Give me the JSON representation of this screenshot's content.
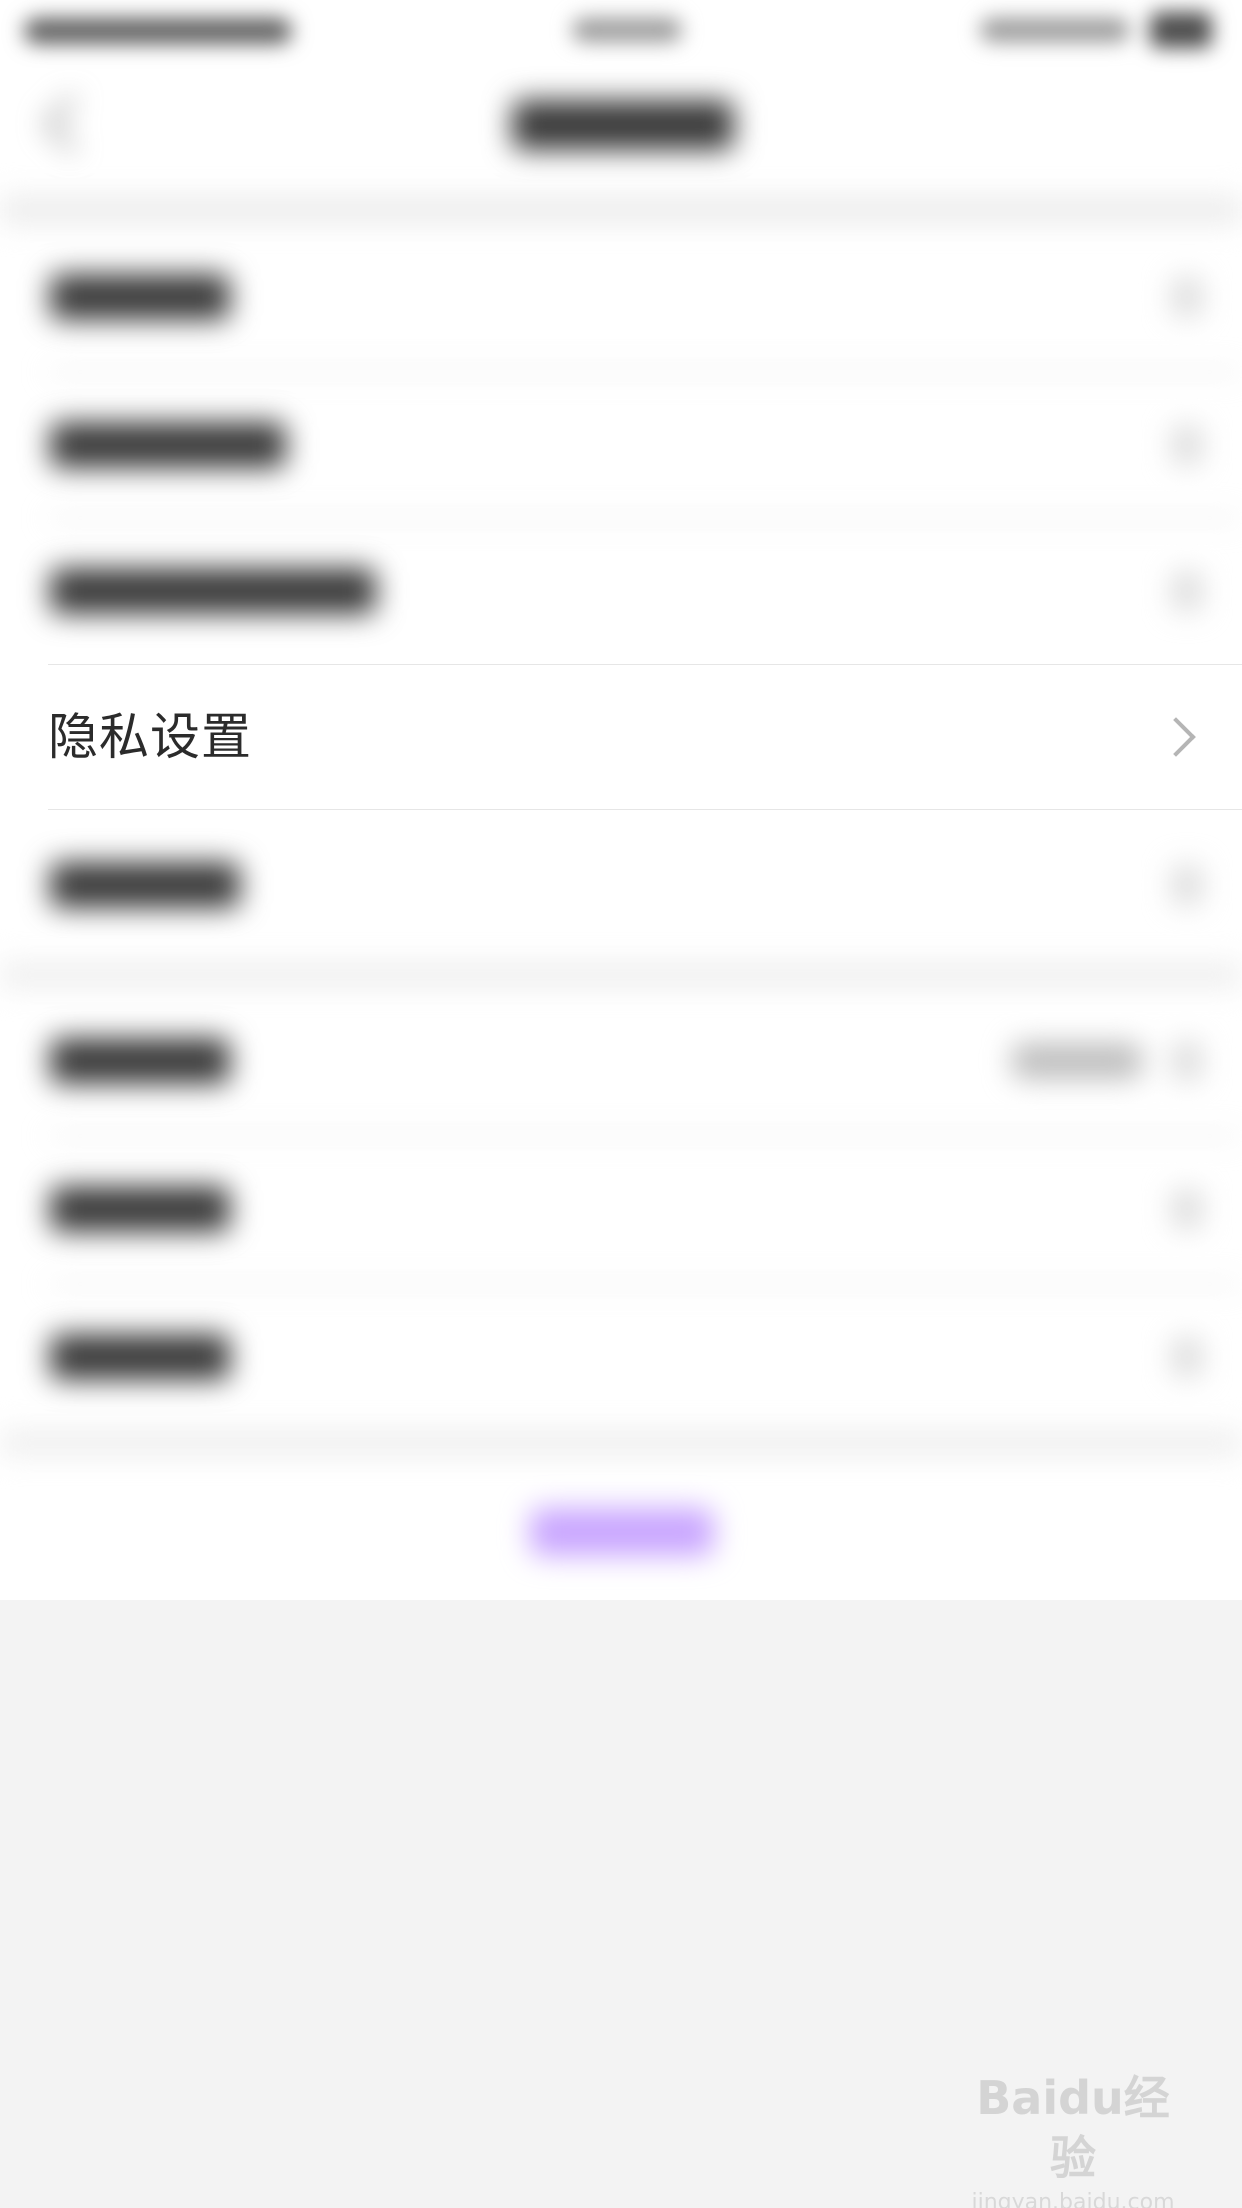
{
  "privacy_row": {
    "label": "隐私设置",
    "icon": "chevron-right-icon"
  },
  "watermark": {
    "logo": "Baidu经验",
    "url": "jingyan.baidu.com"
  },
  "colors": {
    "background": "#f3f3f3",
    "panel": "#ffffff",
    "accent": "#c9a6ff",
    "label_text": "#2b2b2b",
    "chevron": "#b5b5b5"
  }
}
